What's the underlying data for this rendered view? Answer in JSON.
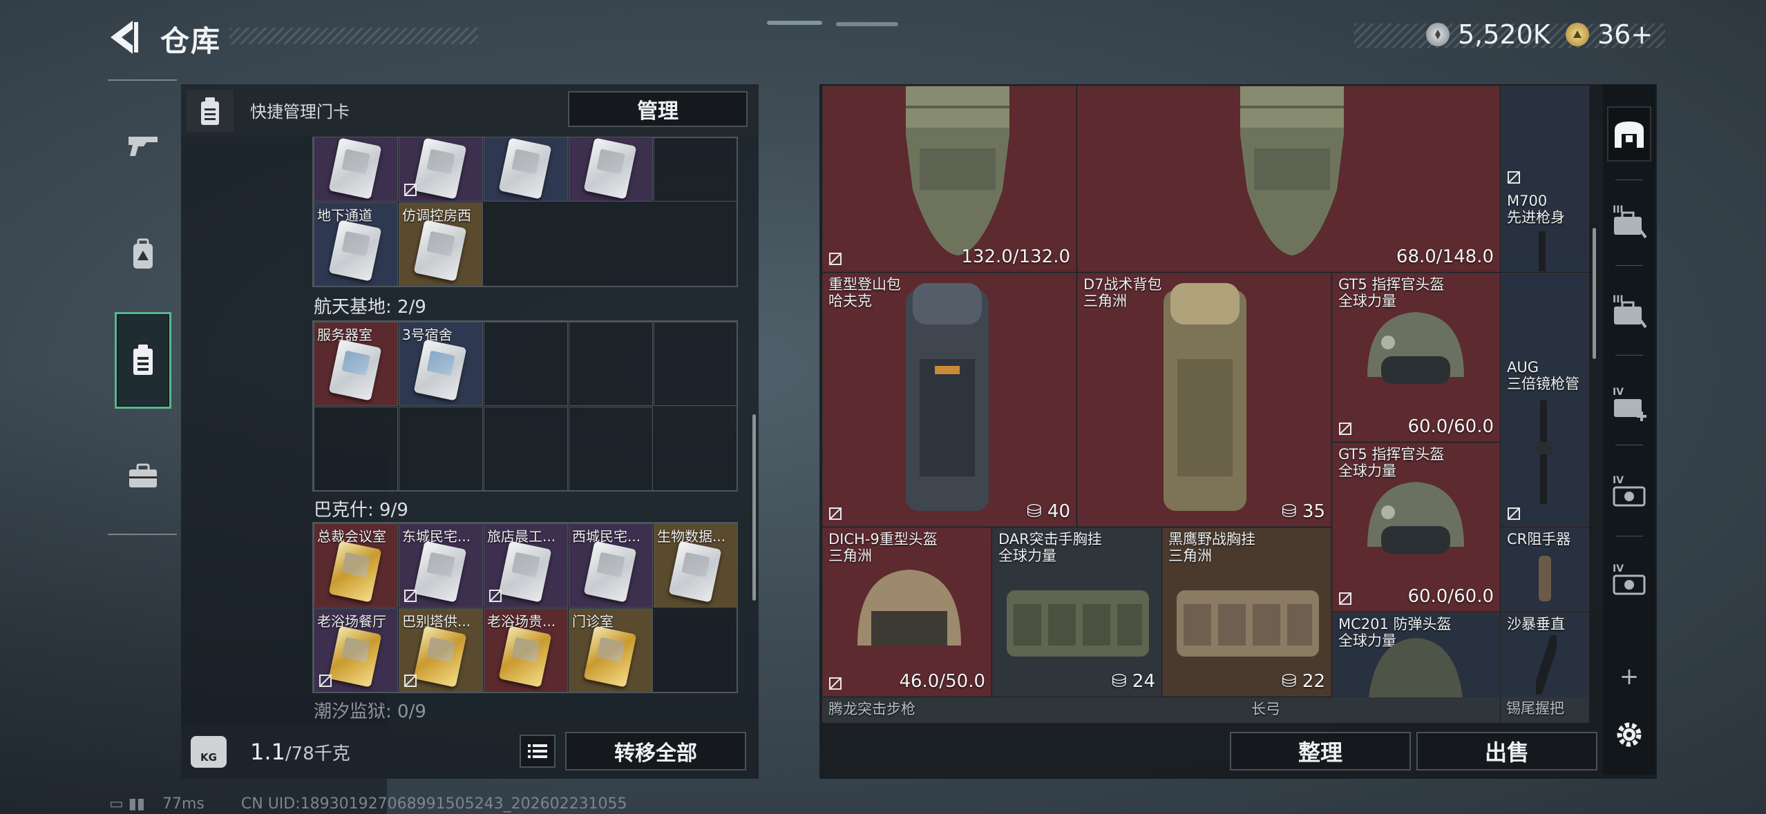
{
  "header": {
    "title": "仓库",
    "currency": [
      {
        "icon": "silver-coin-icon",
        "value": "5,520K"
      },
      {
        "icon": "gold-coin-icon",
        "value": "36+"
      }
    ]
  },
  "left_nav": [
    {
      "icon": "gun-icon",
      "active": false
    },
    {
      "icon": "backpack-icon",
      "active": false
    },
    {
      "icon": "keycard-icon",
      "active": true
    },
    {
      "icon": "briefcase-icon",
      "active": false
    }
  ],
  "keycards": {
    "quick_manage_label": "快捷管理门卡",
    "manage_button": "管理",
    "group0": {
      "row1": [
        "",
        "",
        "",
        ""
      ],
      "row2": [
        "地下通道",
        "仿调控房西"
      ]
    },
    "group1": {
      "title": "航天基地: 2/9",
      "cells": [
        "服务器室",
        "3号宿舍"
      ]
    },
    "group2": {
      "title": "巴克什: 9/9",
      "cells": [
        "总裁会议室",
        "东城民宅...",
        "旅店晨工...",
        "西城民宅...",
        "生物数据...",
        "老浴场餐厅",
        "巴别塔供...",
        "老浴场贵...",
        "门诊室"
      ]
    },
    "group3": {
      "title": "潮汐监狱: 0/9"
    },
    "weight": {
      "value": "1.1",
      "unit": "/78千克",
      "kg_label": "KG"
    },
    "transfer_all_button": "转移全部"
  },
  "stash": {
    "items": [
      {
        "name": "",
        "sub": "",
        "value": "132.0/132.0"
      },
      {
        "name": "",
        "sub": "",
        "value": "68.0/148.0"
      },
      {
        "name": "M700",
        "sub": "先进枪身",
        "value": ""
      },
      {
        "name": "重型登山包",
        "sub": "哈夫克",
        "value": "40"
      },
      {
        "name": "D7战术背包",
        "sub": "三角洲",
        "value": "35"
      },
      {
        "name": "GT5 指挥官头盔",
        "sub": "全球力量",
        "value": "60.0/60.0"
      },
      {
        "name": "AUG",
        "sub": "三倍镜枪管",
        "value": ""
      },
      {
        "name": "GT5 指挥官头盔",
        "sub": "全球力量",
        "value": "60.0/60.0"
      },
      {
        "name": "DICH-9重型头盔",
        "sub": "三角洲",
        "value": "46.0/50.0"
      },
      {
        "name": "DAR突击手胸挂",
        "sub": "全球力量",
        "value": "24"
      },
      {
        "name": "黑鹰野战胸挂",
        "sub": "三角洲",
        "value": "22"
      },
      {
        "name": "CR阻手器",
        "sub": "",
        "value": ""
      },
      {
        "name": "MC201 防弹头盔",
        "sub": "全球力量",
        "value": ""
      },
      {
        "name": "沙暴垂直",
        "sub": "",
        "value": ""
      },
      {
        "name": "腾龙突击步枪",
        "sub": "",
        "value": ""
      },
      {
        "name": "长弓",
        "sub": "",
        "value": ""
      },
      {
        "name": "锡尾握把",
        "sub": "",
        "value": ""
      }
    ],
    "sort_button": "整理",
    "sell_button": "出售"
  },
  "tools": [
    {
      "icon": "safe-icon",
      "label": ""
    },
    {
      "icon": "tier-iii-case-icon",
      "label": "III"
    },
    {
      "icon": "tier-iii-case-icon",
      "label": "III"
    },
    {
      "icon": "tier-iv-add-case-icon",
      "label": "IV"
    },
    {
      "icon": "tier-iv-case-icon",
      "label": "IV"
    },
    {
      "icon": "tier-iv-case-icon",
      "label": "IV"
    },
    {
      "icon": "plus-icon",
      "label": "+"
    },
    {
      "icon": "gear-icon",
      "label": ""
    }
  ],
  "status_bar": {
    "ping": "77ms",
    "uid": "CN UID:189301927068991505243_202602231055"
  },
  "colors": {
    "accent_green": "#58b78c",
    "item_red": "#5c2a2f",
    "item_blue": "#27313f"
  }
}
